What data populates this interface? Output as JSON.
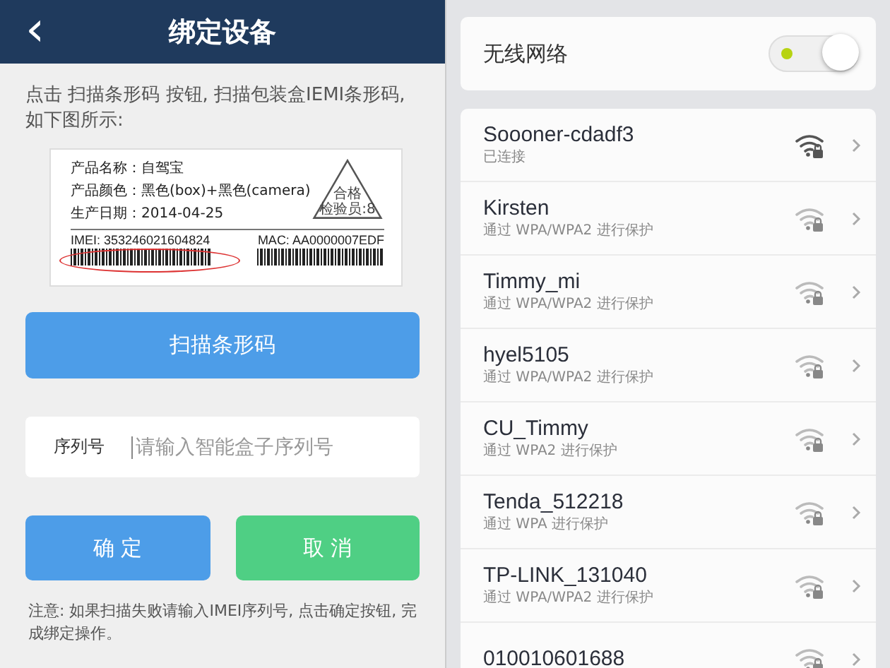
{
  "left_screen": {
    "title": "绑定设备",
    "back_icon": "‹",
    "instructions": "点击 扫描条形码 按钮, 扫描包装盒IEMI条形码, 如下图所示:",
    "product_label": {
      "lines": [
        "产品名称：自驾宝",
        "产品颜色：黑色(box)+黑色(camera)",
        "生产日期：2014-04-25"
      ],
      "stamp": "合格",
      "inspector": "检验员:8",
      "imei": "IMEI: 353246021604824",
      "mac": "MAC: AA0000007EDF"
    },
    "scan_button": "扫描条形码",
    "serial_field": {
      "label": "序列号",
      "placeholder": "请输入智能盒子序列号"
    },
    "buttons": [
      {
        "label": "确 定",
        "kind": "confirm"
      },
      {
        "label": "取 消",
        "kind": "cancel"
      }
    ],
    "note": "注意: 如果扫描失败请输入IMEI序列号, 点击确定按钮, 完成绑定操作。"
  },
  "right_screen": {
    "wifi_toggle": {
      "label": "无线网络",
      "on": true
    },
    "networks": [
      {
        "name": "Soooner-cdadf3",
        "status": "已连接",
        "connected": true
      },
      {
        "name": "Kirsten",
        "status": "通过 WPA/WPA2 进行保护",
        "connected": false
      },
      {
        "name": "Timmy_mi",
        "status": "通过 WPA/WPA2 进行保护",
        "connected": false
      },
      {
        "name": "hyel5105",
        "status": "通过 WPA/WPA2 进行保护",
        "connected": false
      },
      {
        "name": "CU_Timmy",
        "status": "通过 WPA2 进行保护",
        "connected": false
      },
      {
        "name": "Tenda_512218",
        "status": "通过 WPA 进行保护",
        "connected": false
      },
      {
        "name": "TP-LINK_131040",
        "status": "通过 WPA/WPA2 进行保护",
        "connected": false
      },
      {
        "name": "010010601688",
        "connected": false
      }
    ]
  }
}
